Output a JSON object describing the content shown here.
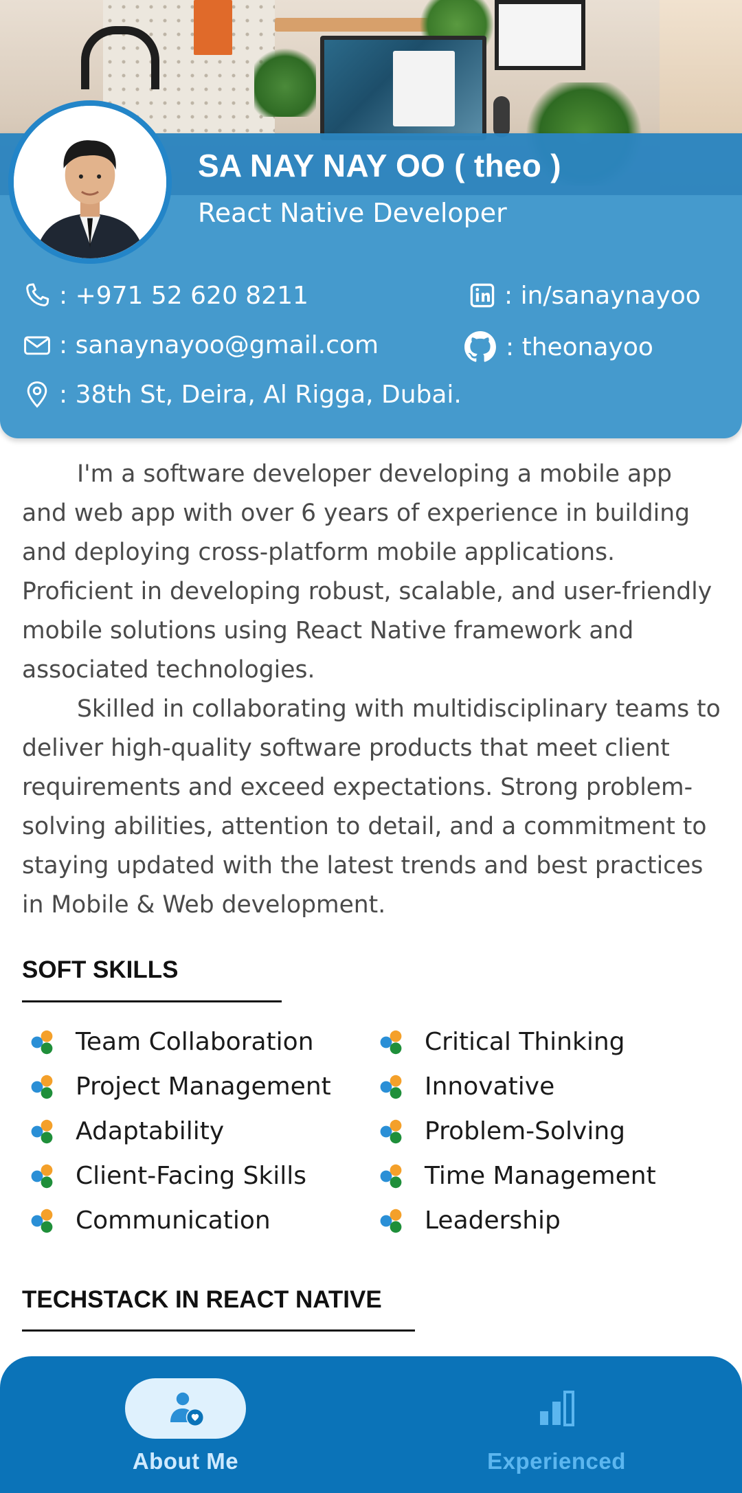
{
  "profile": {
    "name": "SA NAY NAY OO ( theo )",
    "role": "React Native Developer"
  },
  "contacts": {
    "phone": ": +971 52 620 8211",
    "email": ": sanaynayoo@gmail.com",
    "address": ": 38th St, Deira, Al Rigga, Dubai.",
    "linkedin": ": in/sanaynayoo",
    "github": ": theonayoo"
  },
  "about": {
    "paragraphs": [
      "I'm a software developer developing a mobile app and web app with over 6 years of experience in building and deploying cross-platform mobile applications. Proficient in developing robust, scalable, and user-friendly mobile solutions using React Native framework and associated technologies.",
      "Skilled in collaborating with multidisciplinary teams to deliver high-quality software products that meet client requirements and exceed expectations. Strong problem-solving abilities, attention to detail, and a commitment to staying updated with the latest trends and best practices in Mobile & Web development."
    ]
  },
  "soft_skills": {
    "title": "SOFT SKILLS",
    "left": [
      "Team Collaboration",
      "Project Management",
      "Adaptability",
      "Client-Facing Skills",
      "Communication"
    ],
    "right": [
      "Critical Thinking",
      "Innovative",
      "Problem-Solving",
      "Time Management",
      "Leadership"
    ]
  },
  "techstack": {
    "title": "TECHSTACK IN REACT NATIVE"
  },
  "nav": {
    "tabs": [
      {
        "label": "About Me",
        "active": true,
        "icon": "user-badge-icon"
      },
      {
        "label": "Experienced",
        "active": false,
        "icon": "bar-chart-icon"
      }
    ]
  },
  "colors": {
    "card": "#3591c9",
    "nav": "#0b73b8",
    "active_label": "#cfeaff",
    "inactive_label": "#5cb6ef",
    "skill_blue": "#2a8fd6",
    "skill_orange": "#f4a02a",
    "skill_green": "#1f8f3a"
  }
}
